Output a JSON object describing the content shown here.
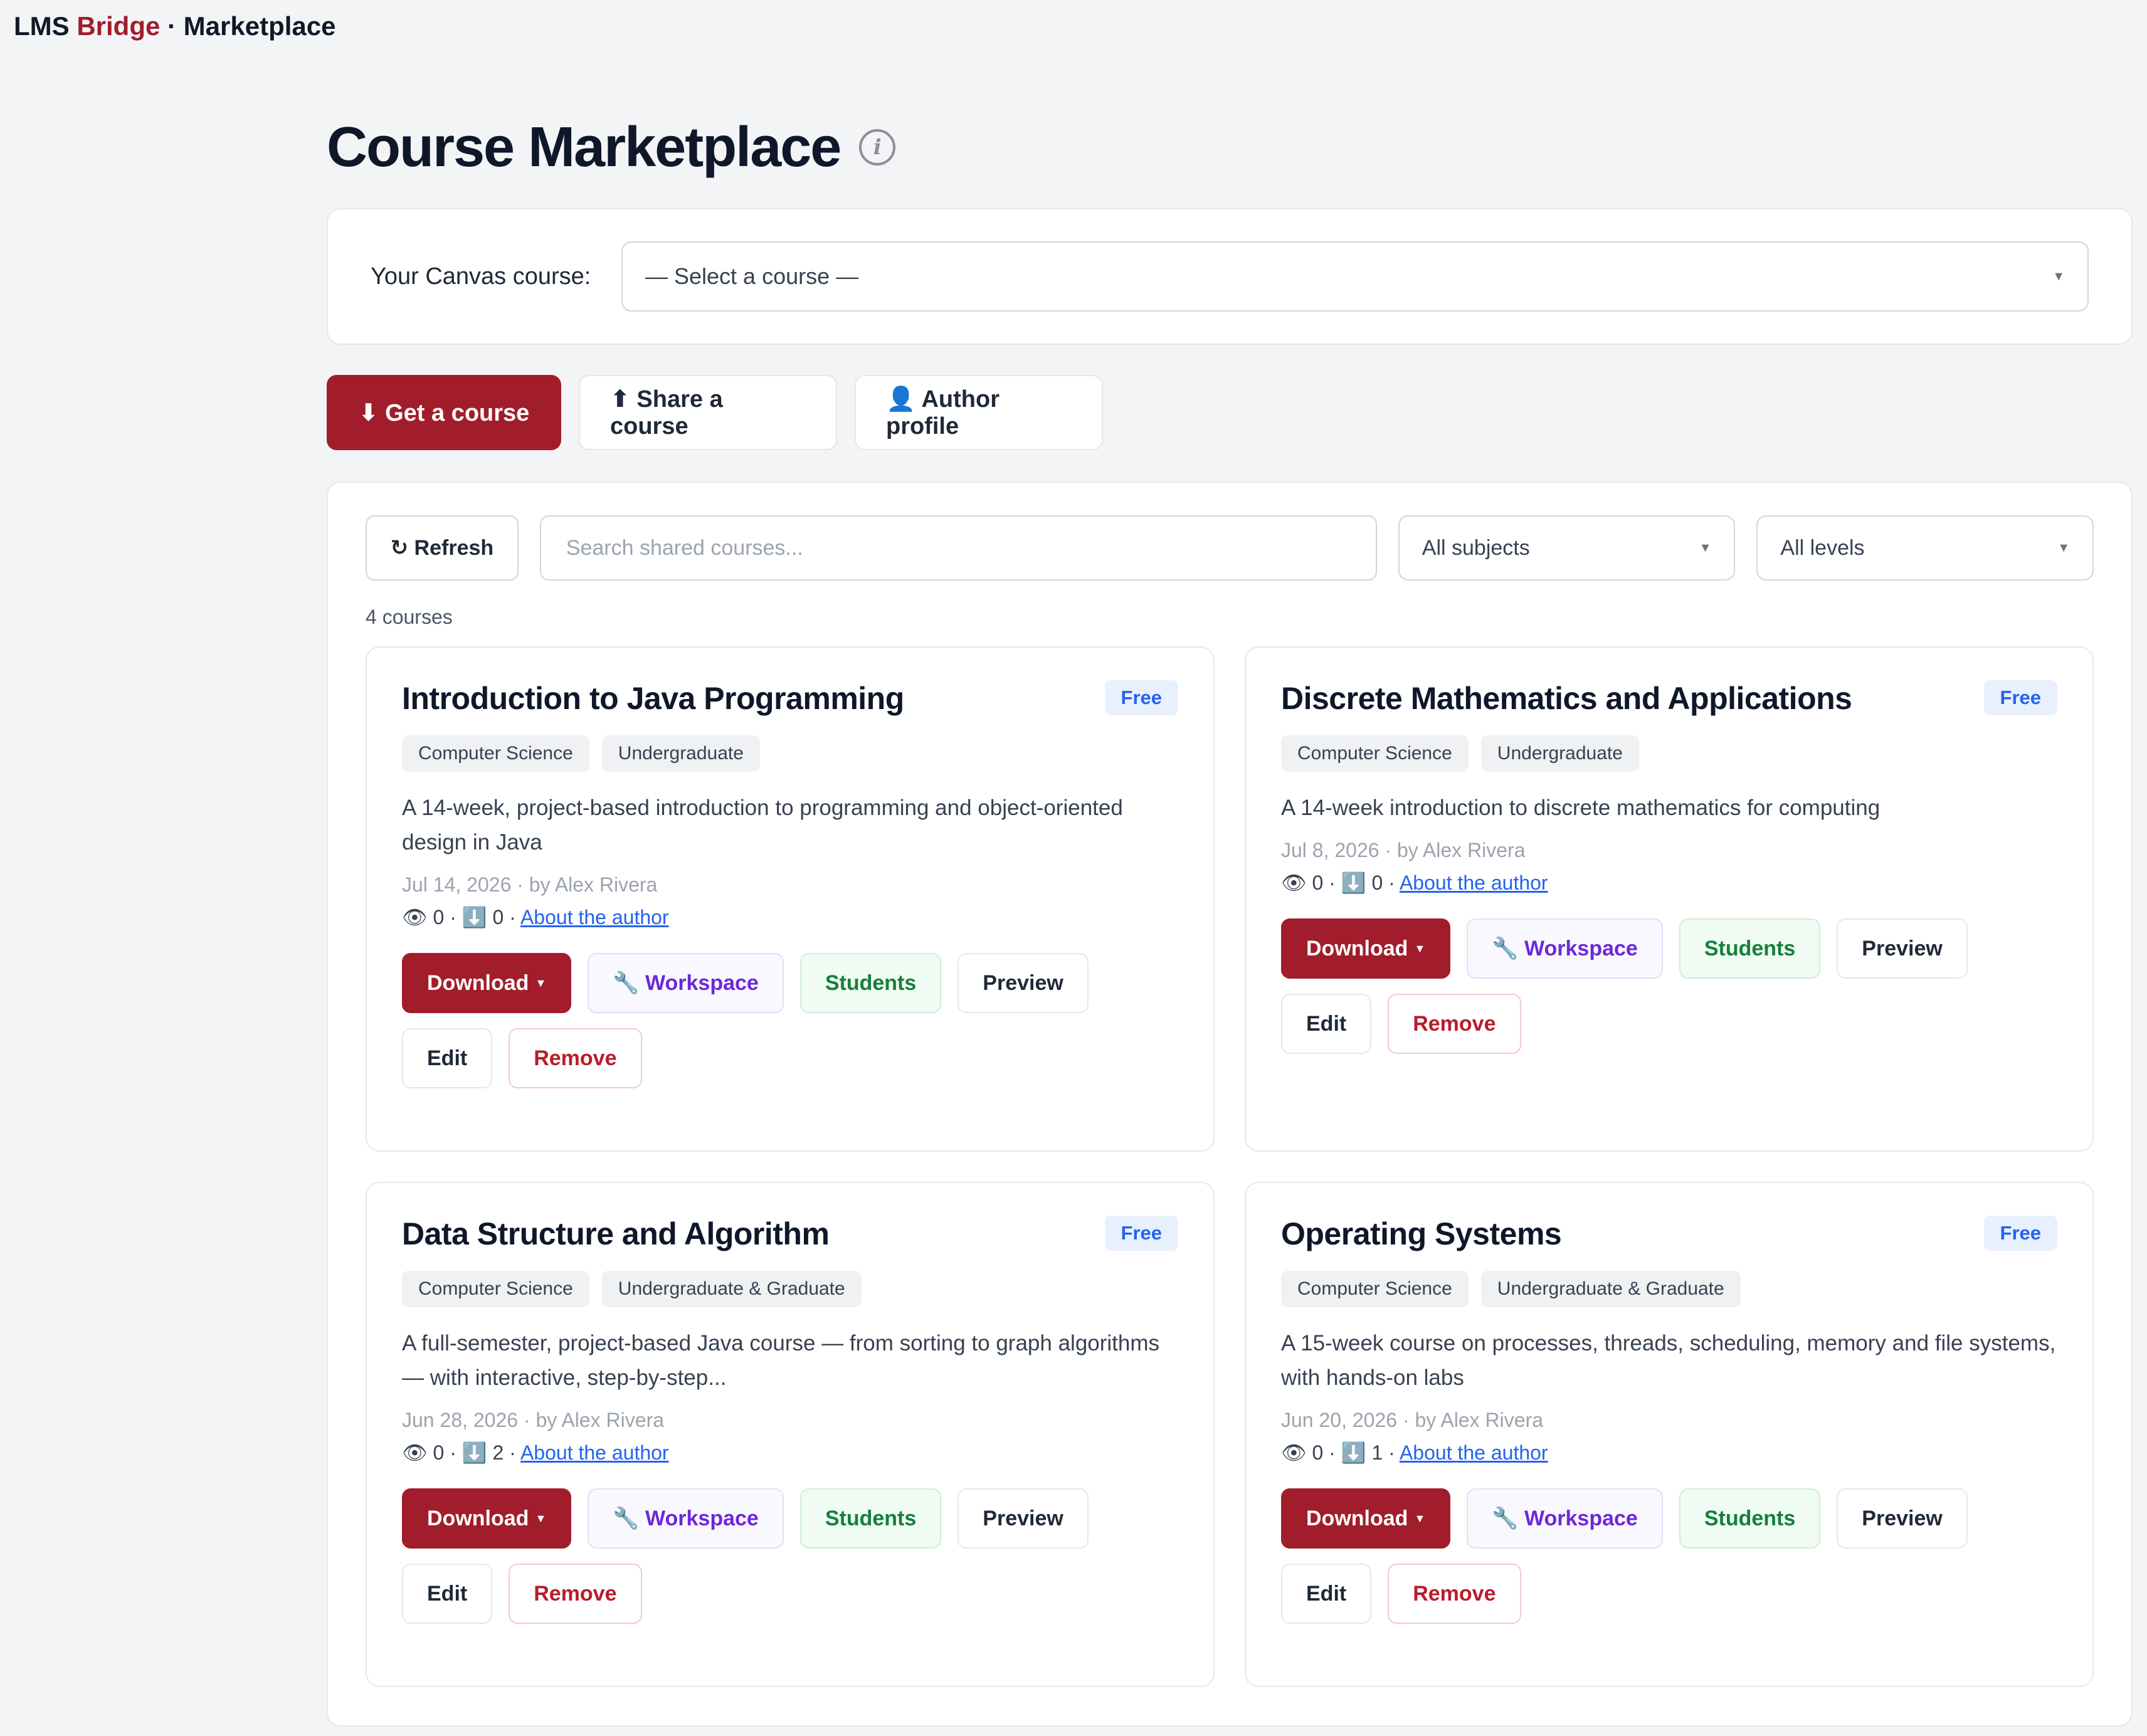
{
  "brand": {
    "prefix": "LMS",
    "accent": "Bridge",
    "suffix": "· Marketplace"
  },
  "page": {
    "title": "Course Marketplace",
    "info_icon": "info-icon"
  },
  "course_picker": {
    "label": "Your Canvas course:",
    "selected": "— Select a course —"
  },
  "actions": {
    "get_course": "⬇ Get a course",
    "share_course": "⬆ Share a course",
    "author_profile": "👤 Author profile"
  },
  "toolbar": {
    "refresh": "↻ Refresh",
    "search_placeholder": "Search shared courses...",
    "subjects": "All subjects",
    "levels": "All levels"
  },
  "count": "4 courses",
  "labels": {
    "download": "Download",
    "workspace": "🔧 Workspace",
    "students": "Students",
    "preview": "Preview",
    "edit": "Edit",
    "remove": "Remove",
    "about": "About the author"
  },
  "courses": [
    {
      "title": "Introduction to Java Programming",
      "price": "Free",
      "subject": "Computer Science",
      "level": "Undergraduate",
      "description": "A 14-week, project-based introduction to programming and object-oriented design in Java",
      "meta": "Jul 14, 2026 · by Alex Rivera",
      "stats": "👁 0 · ⬇️ 0 ·"
    },
    {
      "title": "Discrete Mathematics and Applications",
      "price": "Free",
      "subject": "Computer Science",
      "level": "Undergraduate",
      "description": "A 14-week introduction to discrete mathematics for computing",
      "meta": "Jul 8, 2026 · by Alex Rivera",
      "stats": "👁 0 · ⬇️ 0 ·"
    },
    {
      "title": "Data Structure and Algorithm",
      "price": "Free",
      "subject": "Computer Science",
      "level": "Undergraduate & Graduate",
      "description": "A full-semester, project-based Java course — from sorting to graph algorithms — with interactive, step-by-step...",
      "meta": "Jun 28, 2026 · by Alex Rivera",
      "stats": "👁 0 · ⬇️ 2 ·"
    },
    {
      "title": "Operating Systems",
      "price": "Free",
      "subject": "Computer Science",
      "level": "Undergraduate & Graduate",
      "description": "A 15-week course on processes, threads, scheduling, memory and file systems, with hands-on labs",
      "meta": "Jun 20, 2026 · by Alex Rivera",
      "stats": "👁 0 · ⬇️ 1 ·"
    }
  ]
}
